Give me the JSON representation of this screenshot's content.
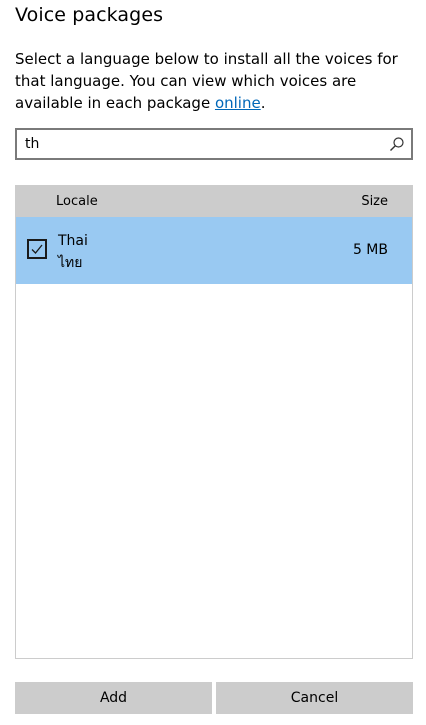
{
  "dialog": {
    "title": "Voice packages",
    "description_prefix": "Select a language below to install all the voices for that language. You can view which voices are available in each package ",
    "description_link": "online",
    "description_suffix": "."
  },
  "search": {
    "value": "th",
    "icon": "search-icon"
  },
  "list": {
    "columns": {
      "locale": "Locale",
      "size": "Size"
    },
    "rows": [
      {
        "name": "Thai",
        "native_name": "ไทย",
        "size": "5 MB",
        "checked": true,
        "selected": true
      }
    ]
  },
  "buttons": {
    "add": "Add",
    "cancel": "Cancel"
  },
  "colors": {
    "accent_link": "#0067b8",
    "selected_row": "#99c9f2",
    "header_bg": "#cccccc",
    "button_bg": "#cccccc"
  }
}
